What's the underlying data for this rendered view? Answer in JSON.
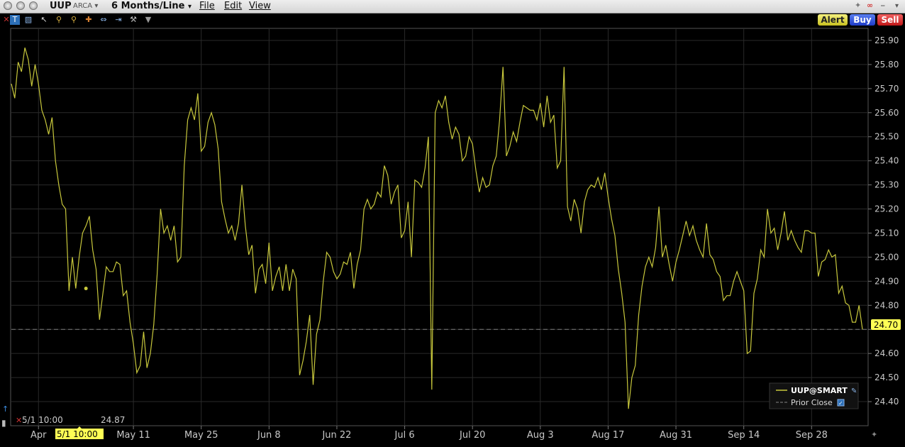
{
  "window": {
    "symbol": "UUP",
    "exchange": "ARCA",
    "period": "6 Months/Line",
    "menus": [
      "File",
      "Edit",
      "View"
    ]
  },
  "actions": {
    "alert": "Alert",
    "buy": "Buy",
    "sell": "Sell"
  },
  "icons": [
    "crosshair-icon",
    "bar-chart-icon",
    "pointer-icon",
    "zoom-in-icon",
    "zoom-out-icon",
    "cursor-cross-icon",
    "fit-icon",
    "arrows-icon",
    "wrench-icon",
    "dropdown-icon"
  ],
  "colors": {
    "line": "#c8c83c",
    "price_tag": "#ffff55",
    "grid": "#2a2a2a",
    "axis_text": "#c8c8c8"
  },
  "cursor_info": {
    "time": "5/1 10:00",
    "value": "24.87",
    "cursor_label": "5/1 10:00"
  },
  "current_price": "24.70",
  "legend": {
    "series": "UUP@SMART",
    "prior_close": "Prior Close",
    "prior_close_checked": true
  },
  "chart_data": {
    "type": "line",
    "ylim": [
      24.3,
      25.95
    ],
    "yticks": [
      "24.40",
      "24.50",
      "24.60",
      "24.70",
      "24.80",
      "24.90",
      "25.00",
      "25.10",
      "25.20",
      "25.30",
      "25.40",
      "25.50",
      "25.60",
      "25.70",
      "25.80",
      "25.90"
    ],
    "xticks": [
      {
        "label": "Apr",
        "idx": 8
      },
      {
        "label": "May 11",
        "idx": 36
      },
      {
        "label": "May 25",
        "idx": 56
      },
      {
        "label": "Jun 8",
        "idx": 76
      },
      {
        "label": "Jun 22",
        "idx": 96
      },
      {
        "label": "Jul 6",
        "idx": 116
      },
      {
        "label": "Jul 20",
        "idx": 136
      },
      {
        "label": "Aug 3",
        "idx": 156
      },
      {
        "label": "Aug 17",
        "idx": 176
      },
      {
        "label": "Aug 31",
        "idx": 196
      },
      {
        "label": "Sep 14",
        "idx": 216
      },
      {
        "label": "Sep 28",
        "idx": 236
      }
    ],
    "prior_close": 24.7,
    "cursor_index": 22,
    "series": [
      {
        "name": "UUP@SMART",
        "values": [
          25.72,
          25.66,
          25.81,
          25.77,
          25.87,
          25.82,
          25.71,
          25.8,
          25.72,
          25.61,
          25.57,
          25.51,
          25.58,
          25.4,
          25.3,
          25.22,
          25.2,
          24.86,
          25.0,
          24.87,
          25.0,
          25.1,
          25.13,
          25.17,
          25.03,
          24.95,
          24.74,
          24.85,
          24.96,
          24.94,
          24.94,
          24.98,
          24.97,
          24.84,
          24.86,
          24.73,
          24.64,
          24.52,
          24.55,
          24.69,
          24.54,
          24.6,
          24.72,
          24.93,
          25.2,
          25.1,
          25.13,
          25.07,
          25.13,
          24.98,
          25.0,
          25.38,
          25.57,
          25.62,
          25.57,
          25.68,
          25.44,
          25.46,
          25.56,
          25.6,
          25.55,
          25.45,
          25.23,
          25.16,
          25.1,
          25.13,
          25.07,
          25.14,
          25.3,
          25.13,
          25.01,
          25.05,
          24.85,
          24.95,
          24.97,
          24.89,
          25.06,
          24.86,
          24.92,
          24.96,
          24.86,
          24.97,
          24.86,
          24.95,
          24.91,
          24.51,
          24.57,
          24.65,
          24.76,
          24.47,
          24.68,
          24.74,
          24.9,
          25.02,
          25.0,
          24.94,
          24.91,
          24.93,
          24.98,
          24.97,
          25.02,
          24.87,
          24.97,
          25.03,
          25.2,
          25.24,
          25.2,
          25.22,
          25.27,
          25.25,
          25.38,
          25.34,
          25.22,
          25.27,
          25.3,
          25.08,
          25.11,
          25.23,
          25.0,
          25.32,
          25.31,
          25.29,
          25.37,
          25.5,
          24.45,
          25.6,
          25.65,
          25.62,
          25.67,
          25.56,
          25.49,
          25.54,
          25.51,
          25.4,
          25.42,
          25.5,
          25.47,
          25.36,
          25.27,
          25.33,
          25.29,
          25.3,
          25.38,
          25.42,
          25.57,
          25.79,
          25.42,
          25.46,
          25.52,
          25.48,
          25.56,
          25.63,
          25.62,
          25.61,
          25.61,
          25.57,
          25.64,
          25.54,
          25.67,
          25.56,
          25.59,
          25.37,
          25.4,
          25.79,
          25.21,
          25.15,
          25.24,
          25.2,
          25.1,
          25.23,
          25.28,
          25.3,
          25.29,
          25.33,
          25.28,
          25.35,
          25.25,
          25.16,
          25.09,
          24.95,
          24.85,
          24.73,
          24.37,
          24.5,
          24.55,
          24.76,
          24.88,
          24.96,
          25.0,
          24.96,
          25.04,
          25.21,
          25.0,
          25.05,
          24.97,
          24.9,
          24.98,
          25.03,
          25.09,
          25.15,
          25.09,
          25.13,
          25.07,
          25.03,
          25.0,
          25.14,
          25.01,
          24.99,
          24.94,
          24.92,
          24.82,
          24.84,
          24.84,
          24.9,
          24.94,
          24.9,
          24.86,
          24.6,
          24.61,
          24.85,
          24.91,
          25.03,
          25.0,
          25.2,
          25.1,
          25.12,
          25.03,
          25.1,
          25.19,
          25.07,
          25.11,
          25.07,
          25.04,
          25.02,
          25.11,
          25.11,
          25.1,
          25.1,
          24.92,
          24.98,
          24.99,
          25.03,
          25.0,
          25.01,
          24.85,
          24.88,
          24.81,
          24.8,
          24.73,
          24.73,
          24.8,
          24.7
        ]
      }
    ]
  }
}
